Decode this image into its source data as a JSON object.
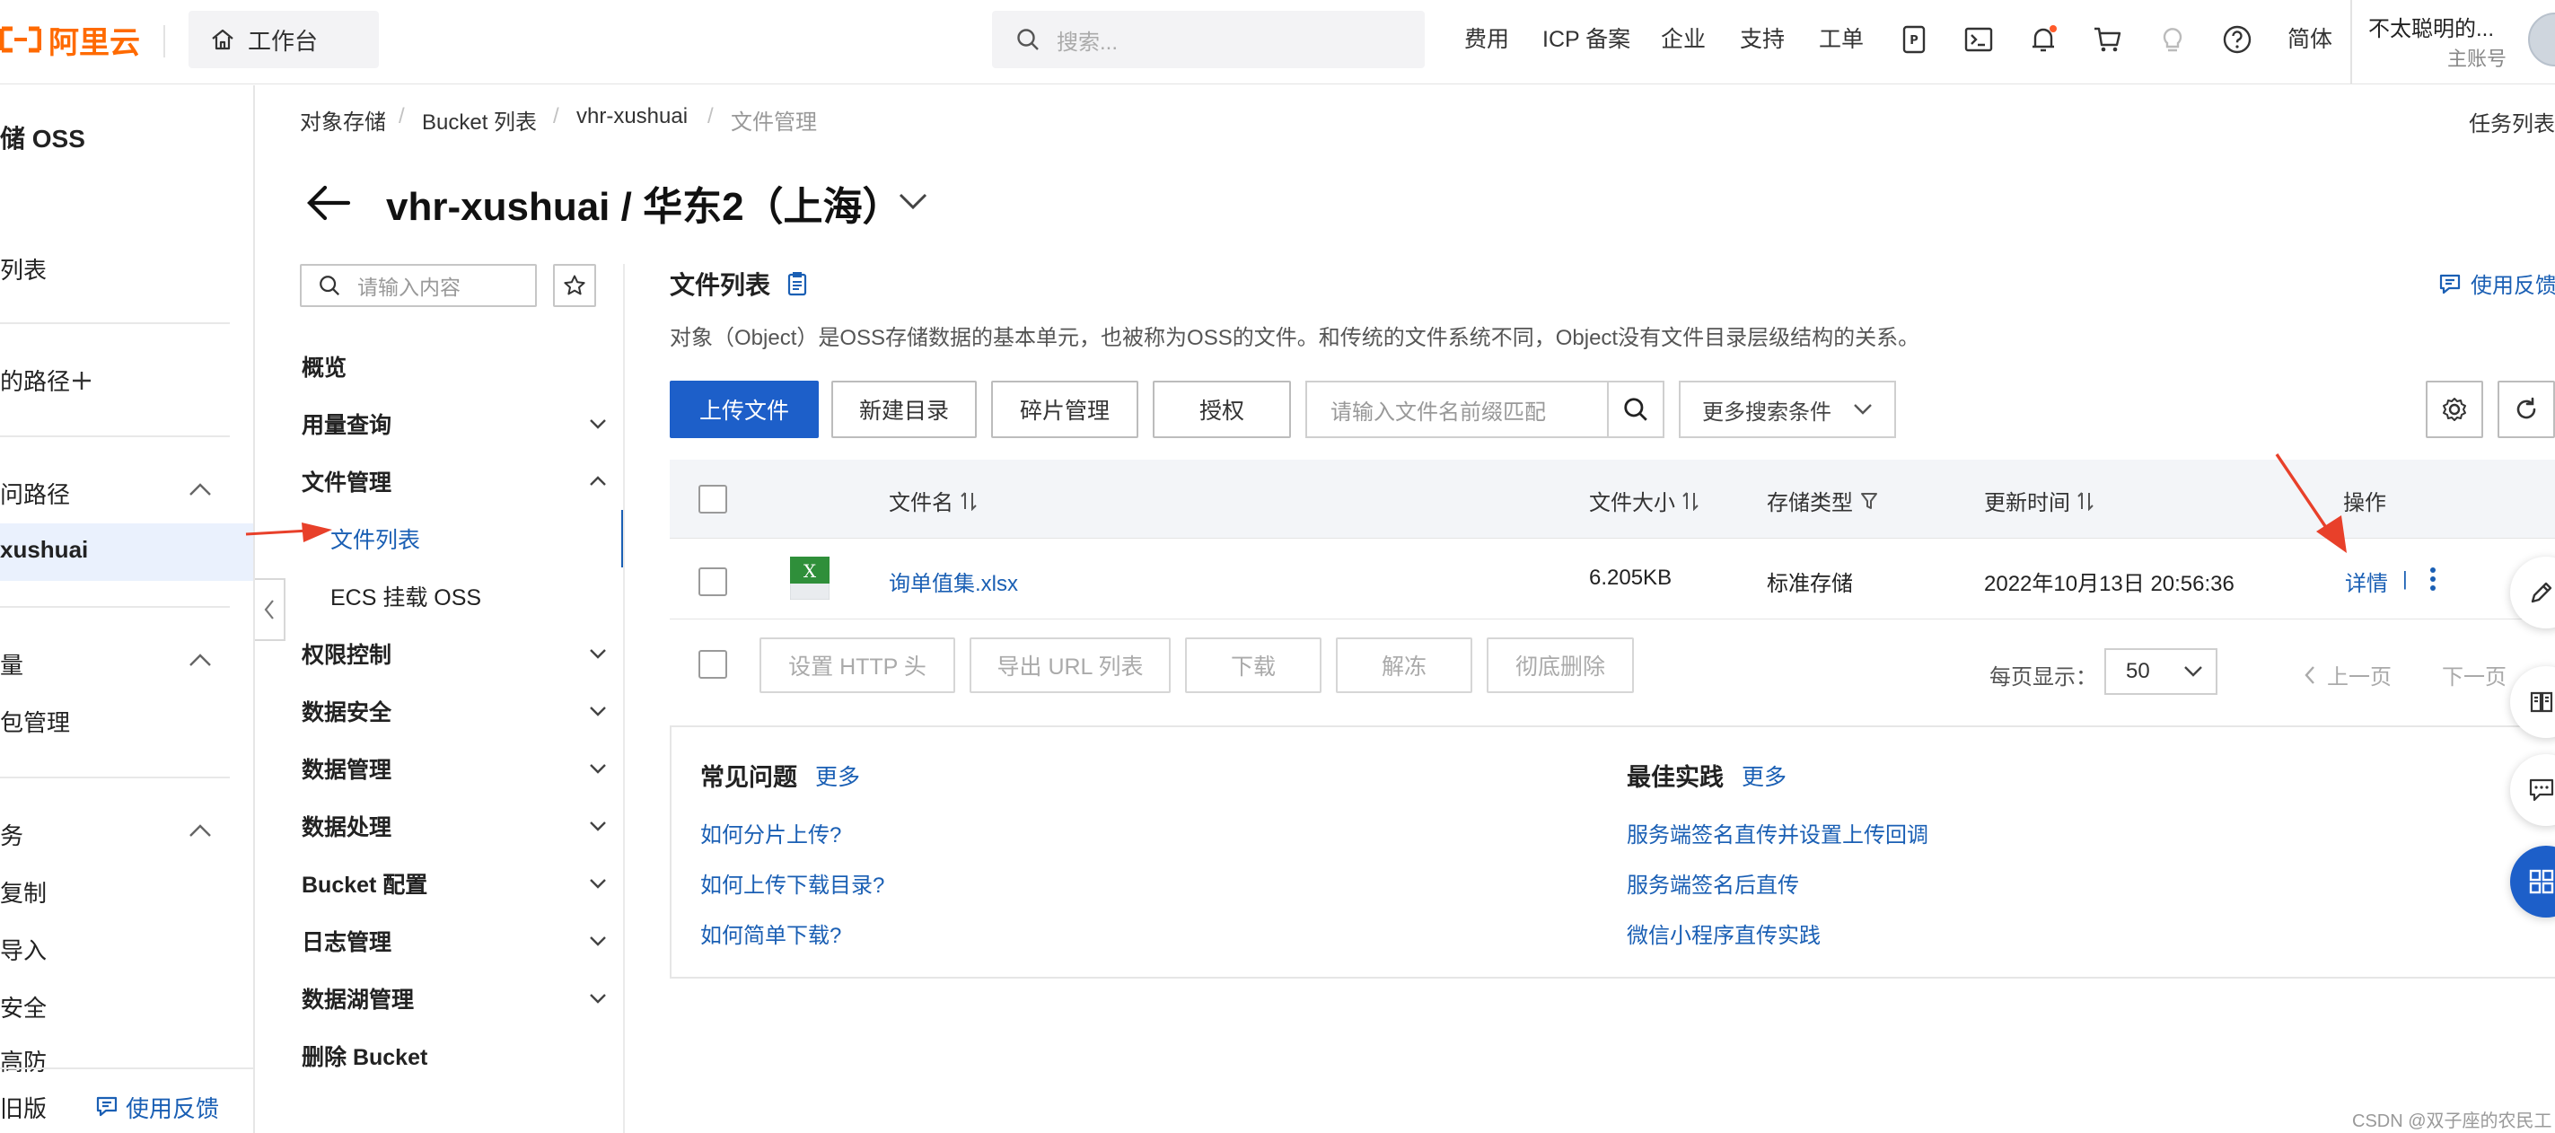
{
  "topbar": {
    "logo_text": "阿里云",
    "workbench": "工作台",
    "search_placeholder": "搜索...",
    "nav": [
      "费用",
      "ICP 备案",
      "企业",
      "支持",
      "工单"
    ],
    "lang": "简体",
    "user_name": "不太聪明的...",
    "user_role": "主账号"
  },
  "left_sidebar": {
    "product": "储 OSS",
    "items": [
      "列表",
      "的路径",
      "问路径",
      "xushuai",
      "量",
      "包管理",
      "务",
      "复制",
      "导入",
      "安全",
      "高防"
    ],
    "old_version": "旧版",
    "feedback": "使用反馈"
  },
  "breadcrumb": [
    "对象存储",
    "Bucket 列表",
    "vhr-xushuai",
    "文件管理"
  ],
  "task_list": "任务列表",
  "page_title": "vhr-xushuai / 华东2（上海）",
  "submenu": {
    "search_placeholder": "请输入内容",
    "items": [
      {
        "label": "概览"
      },
      {
        "label": "用量查询"
      },
      {
        "label": "文件管理"
      },
      {
        "label": "文件列表"
      },
      {
        "label": "ECS 挂载 OSS"
      },
      {
        "label": "权限控制"
      },
      {
        "label": "数据安全"
      },
      {
        "label": "数据管理"
      },
      {
        "label": "数据处理"
      },
      {
        "label": "Bucket 配置"
      },
      {
        "label": "日志管理"
      },
      {
        "label": "数据湖管理"
      },
      {
        "label": "删除 Bucket"
      }
    ]
  },
  "file_list": {
    "title": "文件列表",
    "feedback": "使用反馈",
    "description": "对象（Object）是OSS存储数据的基本单元，也被称为OSS的文件。和传统的文件系统不同，Object没有文件目录层级结构的关系。",
    "buttons": {
      "upload": "上传文件",
      "new_dir": "新建目录",
      "fragments": "碎片管理",
      "authorize": "授权",
      "more_search": "更多搜索条件"
    },
    "filename_placeholder": "请输入文件名前缀匹配",
    "columns": [
      "文件名",
      "文件大小",
      "存储类型",
      "更新时间",
      "操作"
    ],
    "rows": [
      {
        "name": "询单值集.xlsx",
        "size": "6.205KB",
        "storage": "标准存储",
        "updated": "2022年10月13日 20:56:36",
        "action": "详情",
        "sep": "|"
      }
    ],
    "bulk_actions": [
      "设置 HTTP 头",
      "导出 URL 列表",
      "下载",
      "解冻",
      "彻底删除"
    ],
    "page_size_label": "每页显示：",
    "page_size": "50",
    "prev": "上一页",
    "next": "下一页"
  },
  "faq": {
    "common_title": "常见问题",
    "common_more": "更多",
    "common_links": [
      "如何分片上传?",
      "如何上传下载目录?",
      "如何简单下载?"
    ],
    "best_title": "最佳实践",
    "best_more": "更多",
    "best_links": [
      "服务端签名直传并设置上传回调",
      "服务端签名后直传",
      "微信小程序直传实践"
    ]
  },
  "watermark": "CSDN @双子座的农民工",
  "colors": {
    "brand": "#ff6a00",
    "primary": "#1d5fc9",
    "link": "#1a5fb4",
    "annotation": "#e8402a"
  }
}
